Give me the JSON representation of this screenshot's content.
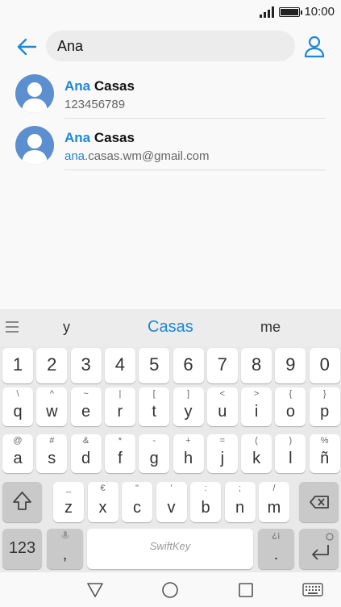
{
  "status": {
    "time": "10:00"
  },
  "search": {
    "query": "Ana"
  },
  "results": [
    {
      "name_highlight": "Ana",
      "name_rest": " Casas",
      "sub_highlight": "",
      "sub_rest": "123456789"
    },
    {
      "name_highlight": "Ana",
      "name_rest": " Casas",
      "sub_highlight": "ana",
      "sub_rest": ".casas.wm@gmail.com"
    }
  ],
  "keyboard": {
    "suggestions": {
      "left": "y",
      "center": "Casas",
      "right": "me"
    },
    "row_numbers": [
      "1",
      "2",
      "3",
      "4",
      "5",
      "6",
      "7",
      "8",
      "9",
      "0"
    ],
    "row1": [
      {
        "k": "q",
        "a": "\\"
      },
      {
        "k": "w",
        "a": "^"
      },
      {
        "k": "e",
        "a": "~"
      },
      {
        "k": "r",
        "a": "|"
      },
      {
        "k": "t",
        "a": "["
      },
      {
        "k": "y",
        "a": "]"
      },
      {
        "k": "u",
        "a": "<"
      },
      {
        "k": "i",
        "a": ">"
      },
      {
        "k": "o",
        "a": "{"
      },
      {
        "k": "p",
        "a": "}"
      }
    ],
    "row2": [
      {
        "k": "a",
        "a": "@"
      },
      {
        "k": "s",
        "a": "#"
      },
      {
        "k": "d",
        "a": "&"
      },
      {
        "k": "f",
        "a": "*"
      },
      {
        "k": "g",
        "a": "-"
      },
      {
        "k": "h",
        "a": "+"
      },
      {
        "k": "j",
        "a": "="
      },
      {
        "k": "k",
        "a": "("
      },
      {
        "k": "l",
        "a": ")"
      },
      {
        "k": "ñ",
        "a": "%"
      }
    ],
    "row3": [
      {
        "k": "z",
        "a": "_"
      },
      {
        "k": "x",
        "a": "€"
      },
      {
        "k": "c",
        "a": "\""
      },
      {
        "k": "v",
        "a": "'"
      },
      {
        "k": "b",
        "a": ":"
      },
      {
        "k": "n",
        "a": ";"
      },
      {
        "k": "m",
        "a": "/"
      }
    ],
    "numbers_key": "123",
    "comma_key": ",",
    "comma_alt": "",
    "space_brand": "SwiftKey",
    "period_key": ".",
    "period_alt": "¿¡"
  },
  "colors": {
    "accent": "#1e87d6",
    "avatar": "#5b8fcf"
  }
}
